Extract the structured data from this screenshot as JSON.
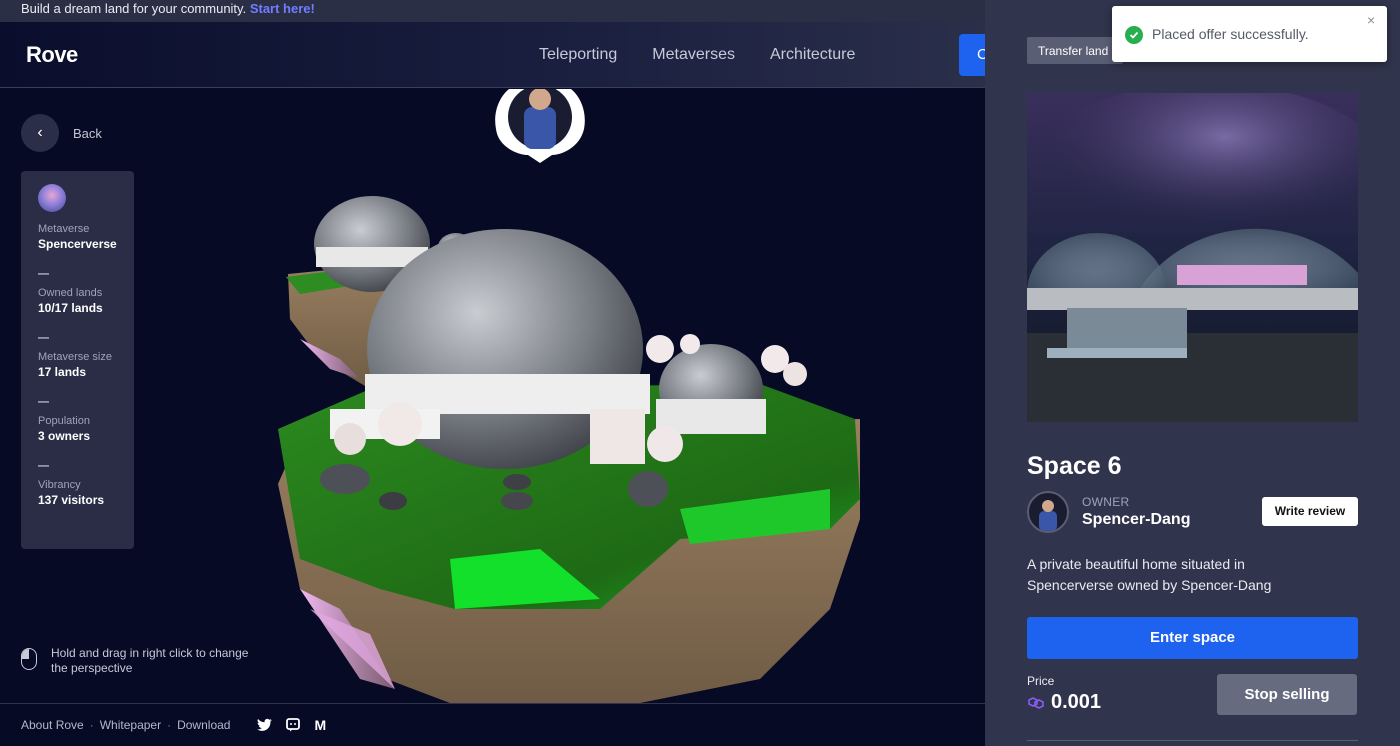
{
  "announcement": {
    "text": "Build a dream land for your community.",
    "link": "Start here!"
  },
  "header": {
    "logo": "Rove",
    "nav": [
      "Teleporting",
      "Metaverses",
      "Architecture"
    ],
    "cta_label": "C"
  },
  "scene": {
    "back_label": "Back",
    "metaverse": {
      "items": [
        {
          "label": "Metaverse",
          "value": "Spencerverse"
        },
        {
          "label": "Owned lands",
          "value": "10/17 lands"
        },
        {
          "label": "Metaverse size",
          "value": "17 lands"
        },
        {
          "label": "Population",
          "value": "3 owners"
        },
        {
          "label": "Vibrancy",
          "value": "137 visitors"
        }
      ],
      "separator": "—"
    },
    "hint": "Hold and drag in right click to change the perspective"
  },
  "footer": {
    "links": [
      "About Rove",
      "Whitepaper",
      "Download"
    ],
    "separator": "·",
    "social_m": "M"
  },
  "panel": {
    "transfer_label": "Transfer land",
    "title": "Space 6",
    "owner_label": "OWNER",
    "owner_name": "Spencer-Dang",
    "review_label": "Write review",
    "description": "A private beautiful home situated in Spencerverse owned by Spencer-Dang",
    "enter_label": "Enter space",
    "price_label": "Price",
    "price_value": "0.001",
    "stop_label": "Stop selling"
  },
  "toast": {
    "message": "Placed offer successfully.",
    "close": "×"
  },
  "colors": {
    "accent": "#1e63f0",
    "success": "#27ae4f",
    "panel": "#30344c",
    "background": "#070a24"
  }
}
